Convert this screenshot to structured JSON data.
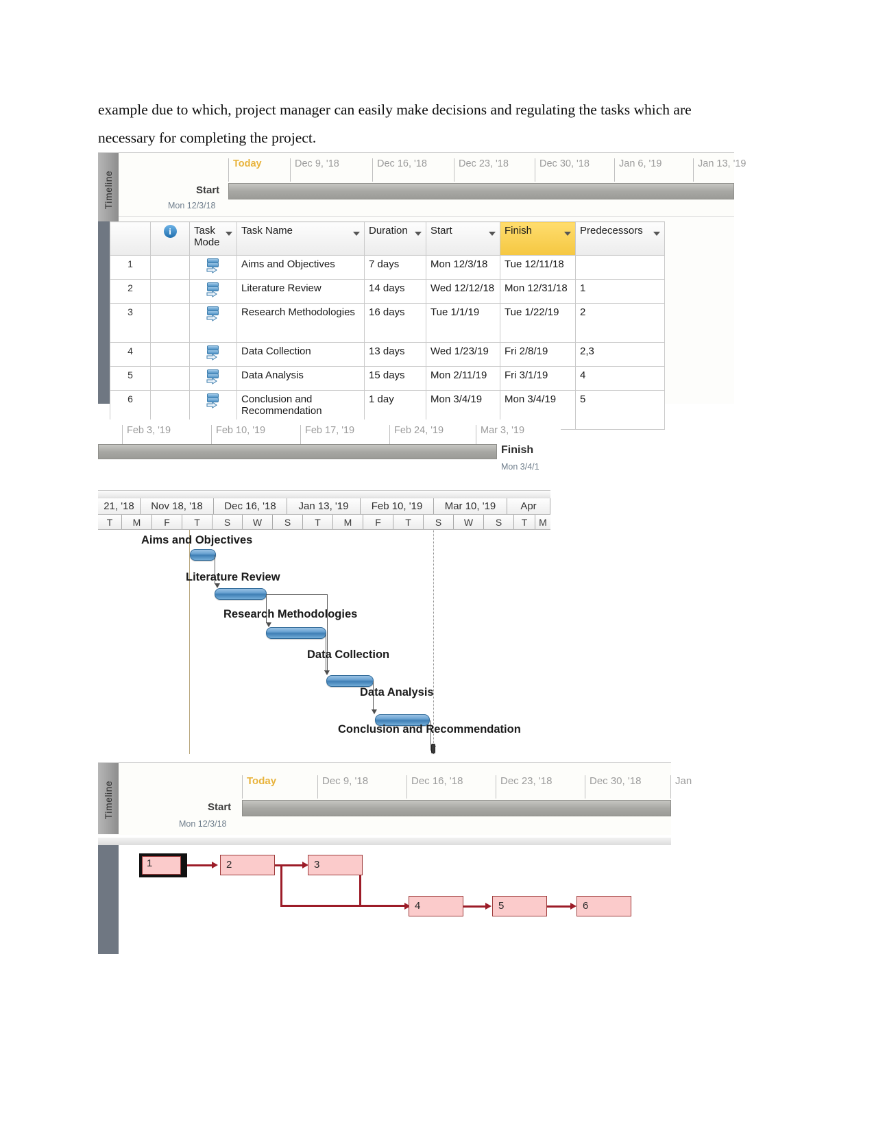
{
  "paragraph": "example due to which, project manager can easily make decisions and regulating the tasks which are necessary for completing the project.",
  "timeline1": {
    "gutter_label": "Timeline",
    "today_label": "Today",
    "ticks": [
      "Dec 9, '18",
      "Dec 16, '18",
      "Dec 23, '18",
      "Dec 30, '18",
      "Jan 6, '19",
      "Jan 13, '19"
    ],
    "start_label": "Start",
    "start_date": "Mon 12/3/18"
  },
  "task_table": {
    "columns": [
      "",
      "",
      "Task Mode",
      "Task Name",
      "Duration",
      "Start",
      "Finish",
      "Predecessors"
    ],
    "headers": {
      "info": "i",
      "task_mode": "Task Mode",
      "task_name": "Task Name",
      "duration": "Duration",
      "start": "Start",
      "finish": "Finish",
      "predecessors": "Predecessors"
    },
    "rows": [
      {
        "id": "1",
        "name": "Aims and Objectives",
        "duration": "7 days",
        "start": "Mon 12/3/18",
        "finish": "Tue 12/11/18",
        "pred": ""
      },
      {
        "id": "2",
        "name": "Literature Review",
        "duration": "14 days",
        "start": "Wed 12/12/18",
        "finish": "Mon 12/31/18",
        "pred": "1"
      },
      {
        "id": "3",
        "name": "Research Methodologies",
        "duration": "16 days",
        "start": "Tue 1/1/19",
        "finish": "Tue 1/22/19",
        "pred": "2"
      },
      {
        "id": "4",
        "name": "Data Collection",
        "duration": "13 days",
        "start": "Wed 1/23/19",
        "finish": "Fri 2/8/19",
        "pred": "2,3"
      },
      {
        "id": "5",
        "name": "Data Analysis",
        "duration": "15 days",
        "start": "Mon 2/11/19",
        "finish": "Fri 3/1/19",
        "pred": "4"
      },
      {
        "id": "6",
        "name": "Conclusion and Recommendation",
        "duration": "1 day",
        "start": "Mon 3/4/19",
        "finish": "Mon 3/4/19",
        "pred": "5"
      }
    ]
  },
  "timeline2": {
    "ticks": [
      "Feb 3, '19",
      "Feb 10, '19",
      "Feb 17, '19",
      "Feb 24, '19",
      "Mar 3, '19"
    ],
    "finish_label": "Finish",
    "finish_date": "Mon 3/4/1"
  },
  "gantt": {
    "month_ticks": [
      "21, '18",
      "Nov 18, '18",
      "Dec 16, '18",
      "Jan 13, '19",
      "Feb 10, '19",
      "Mar 10, '19",
      "Apr"
    ],
    "day_ticks": [
      "T",
      "M",
      "F",
      "T",
      "S",
      "W",
      "S",
      "T",
      "M",
      "F",
      "T",
      "S",
      "W",
      "S",
      "T",
      "M"
    ],
    "bars": [
      {
        "label": "Aims and Objectives"
      },
      {
        "label": "Literature Review"
      },
      {
        "label": "Research Methodologies"
      },
      {
        "label": "Data Collection"
      },
      {
        "label": "Data Analysis"
      },
      {
        "label": "Conclusion and Recommendation"
      }
    ]
  },
  "timeline3": {
    "gutter_label": "Timeline",
    "today_label": "Today",
    "ticks": [
      "Dec 9, '18",
      "Dec 16, '18",
      "Dec 23, '18",
      "Dec 30, '18",
      "Jan"
    ],
    "start_label": "Start",
    "start_date": "Mon 12/3/18"
  },
  "network": {
    "nodes": [
      {
        "id": "1",
        "critical": true
      },
      {
        "id": "2",
        "critical": false
      },
      {
        "id": "3",
        "critical": false
      },
      {
        "id": "4",
        "critical": false
      },
      {
        "id": "5",
        "critical": false
      },
      {
        "id": "6",
        "critical": false
      }
    ]
  },
  "colors": {
    "finish_header": "#f5c741",
    "gantt_bar": "#3f7fb5",
    "network_node": "#fbcbcb",
    "network_link": "#9c1c28",
    "today_accent": "#e8b33c"
  }
}
